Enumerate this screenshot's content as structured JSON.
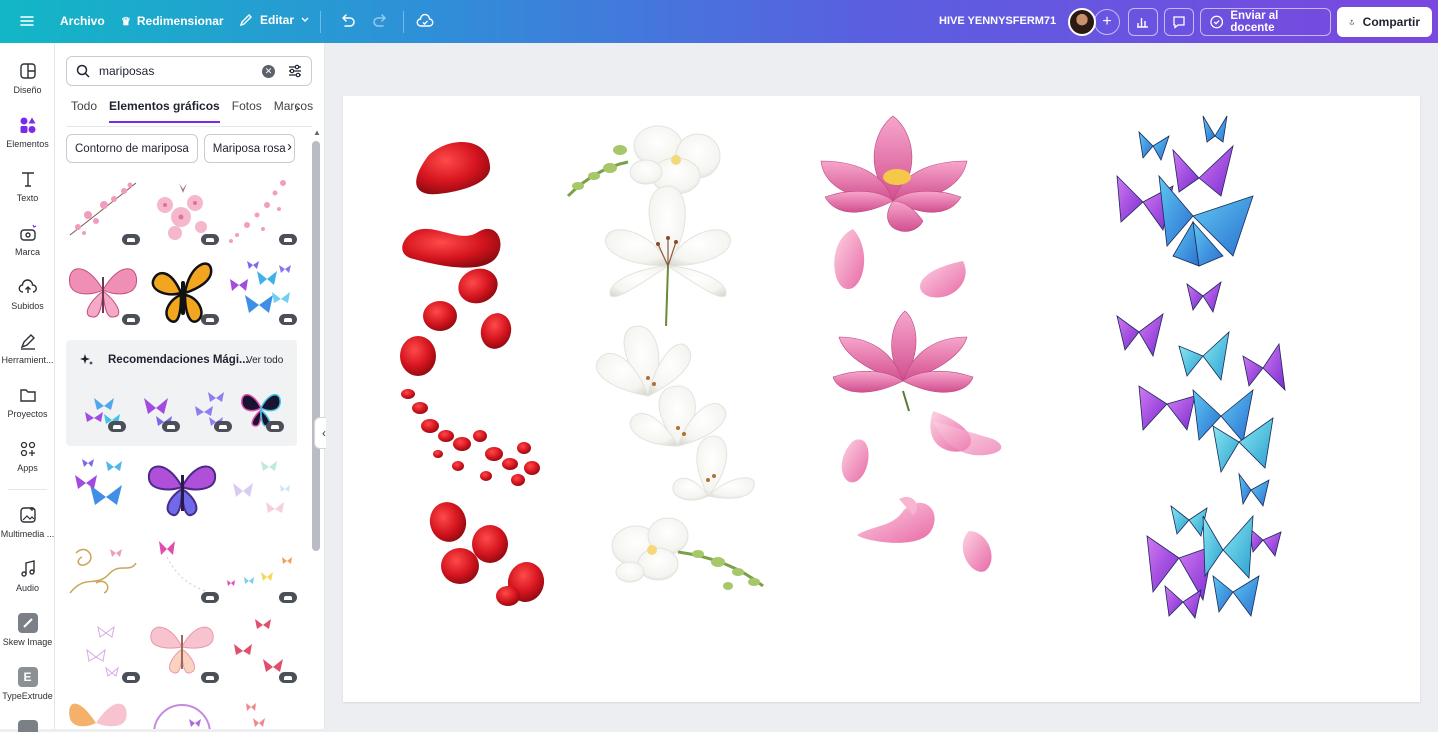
{
  "topbar": {
    "menu_icon": "hamburger-icon",
    "file": "Archivo",
    "resize": "Redimensionar",
    "edit": "Editar",
    "project_name": "HIVE YENNYSFERM71",
    "send_teacher": "Enviar al docente",
    "share": "Compartir"
  },
  "rail": [
    {
      "label": "Diseño",
      "icon": "layout-icon"
    },
    {
      "label": "Elementos",
      "icon": "shapes-icon"
    },
    {
      "label": "Texto",
      "icon": "text-icon"
    },
    {
      "label": "Marca",
      "icon": "brand-icon"
    },
    {
      "label": "Subidos",
      "icon": "upload-icon"
    },
    {
      "label": "Herramient...",
      "icon": "pen-icon"
    },
    {
      "label": "Proyectos",
      "icon": "folder-icon"
    },
    {
      "label": "Apps",
      "icon": "apps-icon"
    },
    {
      "label": "Multimedia ...",
      "icon": "media-icon"
    },
    {
      "label": "Audio",
      "icon": "music-icon"
    },
    {
      "label": "Skew Image",
      "icon": "skew-icon"
    },
    {
      "label": "TypeExtrude",
      "icon": "typeextrude-icon"
    }
  ],
  "panel": {
    "search_value": "mariposas",
    "tabs": [
      "Todo",
      "Elementos gráficos",
      "Fotos",
      "Marcos"
    ],
    "chips": [
      "Contorno de mariposa",
      "Mariposa rosa"
    ],
    "magic_title": "Recomendaciones Mági...",
    "magic_see_all": "Ver todo"
  },
  "colors": {
    "accent": "#7d2ae8",
    "rose_red": "#d4141e",
    "lotus_pink": "#e86aa6",
    "butterfly_blue": "#3f8fe6",
    "butterfly_purple": "#a24be0"
  }
}
